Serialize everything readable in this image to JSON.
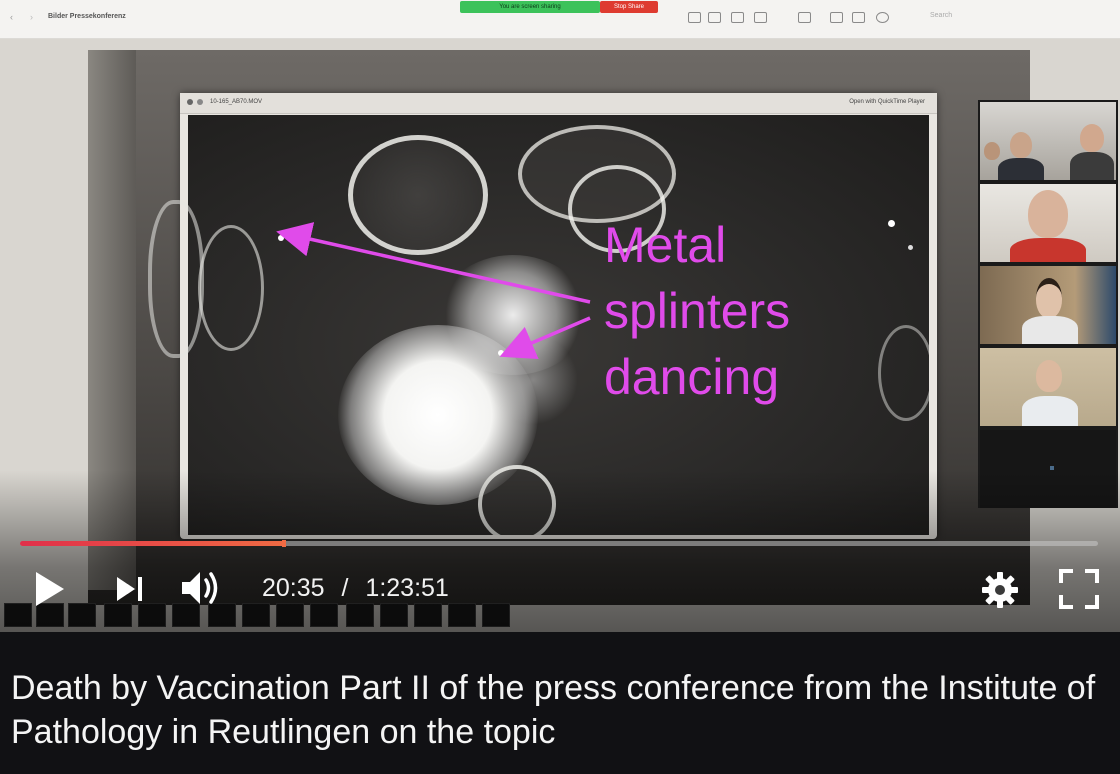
{
  "recorded_screen": {
    "window_title": "Bilder Pressekonferenz",
    "share_status": "You are screen sharing",
    "stop_share_label": "Stop Share",
    "search_placeholder": "Search",
    "video_file_name": "10-165_AB70.MOV",
    "quicktime_label": "Open with QuickTime Player"
  },
  "annotation": {
    "line1": "Metal",
    "line2": "splinters",
    "line3": "dancing",
    "color": "#e04bea"
  },
  "player": {
    "current_time": "20:35",
    "separator": "/",
    "duration": "1:23:51",
    "progress_fraction": 0.2453,
    "progress_color": "#e0304a",
    "icons": {
      "play": "play-icon",
      "next": "skip-next-icon",
      "volume": "volume-icon",
      "settings": "gear-icon",
      "fullscreen": "fullscreen-icon"
    }
  },
  "description": {
    "text": "Death by Vaccination Part II of the press conference from the Institute of Pathology in Reutlingen on the topic"
  }
}
